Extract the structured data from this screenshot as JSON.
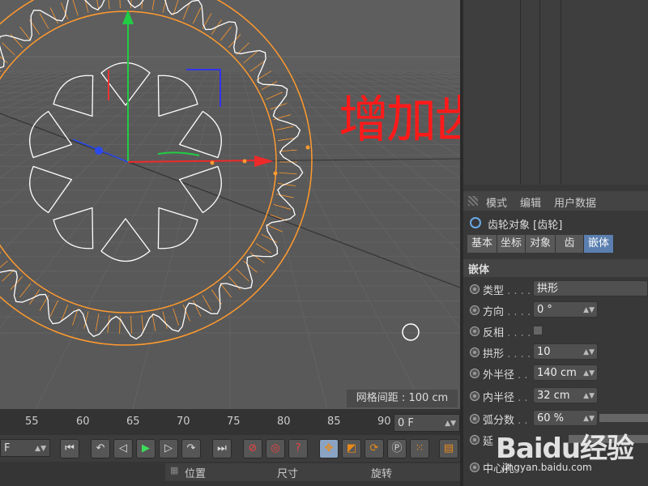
{
  "viewport": {
    "caption": "增加齿轮内部",
    "grid_spacing": "网格间距 : 100 cm"
  },
  "attributes": {
    "menu": [
      "模式",
      "编辑",
      "用户数据"
    ],
    "object_title": "齿轮对象 [齿轮]",
    "tabs": [
      "基本",
      "坐标",
      "对象",
      "齿",
      "嵌体"
    ],
    "active_tab": "嵌体",
    "section": "嵌体",
    "props": {
      "type": {
        "label": "类型",
        "value": "拱形"
      },
      "direction": {
        "label": "方向",
        "value": "0 °"
      },
      "invert": {
        "label": "反相"
      },
      "arches": {
        "label": "拱形",
        "value": "10"
      },
      "outer_radius": {
        "label": "外半径",
        "value": "140 cm"
      },
      "inner_radius": {
        "label": "内半径",
        "value": "32 cm"
      },
      "arc_segments": {
        "label": "弧分数",
        "value": "60 %"
      },
      "extend": {
        "label": "延"
      },
      "center": {
        "label": "中心孔"
      }
    }
  },
  "timeline": {
    "ticks": [
      "55",
      "60",
      "65",
      "70",
      "75",
      "80",
      "85",
      "90"
    ],
    "current_frame": "0 F",
    "fps_field": "F"
  },
  "coord_manager": {
    "headers": [
      "位置",
      "尺寸",
      "旋转"
    ]
  },
  "watermark": {
    "logo": "Baidu经验",
    "url": "jingyan.baidu.com"
  },
  "colors": {
    "caption": "#ff1a1a",
    "gear_outline": "#ff9a2e",
    "y_axis": "#22cc44",
    "x_axis": "#ee2a2a",
    "z_axis": "#2a4aee",
    "tab_active": "#5a7fb0"
  }
}
